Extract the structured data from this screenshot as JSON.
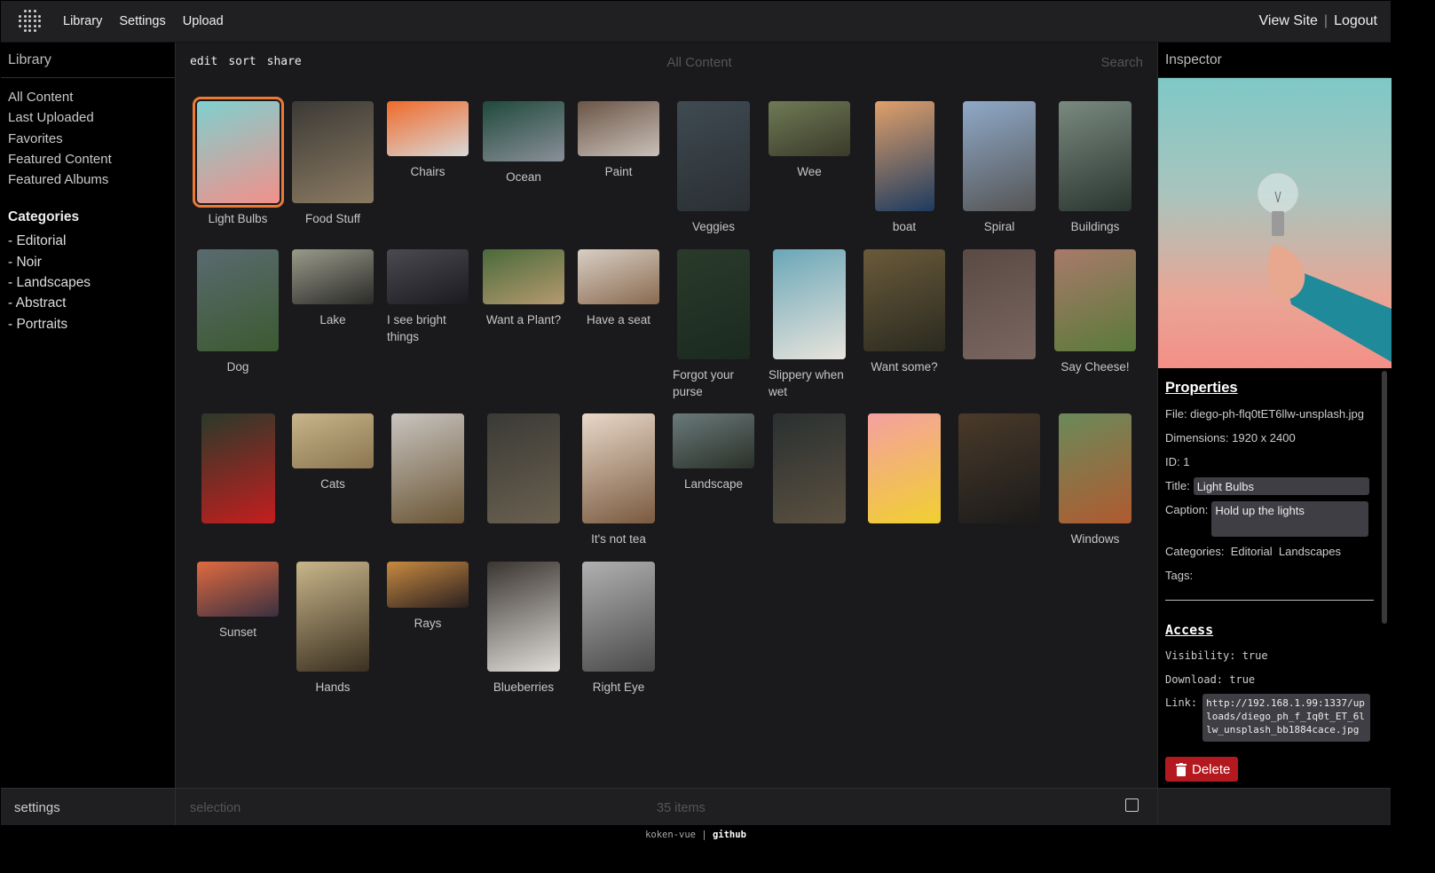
{
  "topbar": {
    "nav": [
      "Library",
      "Settings",
      "Upload"
    ],
    "view_site": "View Site",
    "separator": "|",
    "logout": "Logout"
  },
  "sidebar": {
    "title": "Library",
    "links": [
      "All Content",
      "Last Uploaded",
      "Favorites",
      "Featured Content",
      "Featured Albums"
    ],
    "categories_title": "Categories",
    "categories": [
      "- Editorial",
      "- Noir",
      "- Landscapes",
      "- Abstract",
      "- Portraits"
    ]
  },
  "toolbar": {
    "actions": [
      "edit",
      "sort",
      "share"
    ],
    "title": "All Content",
    "search_placeholder": "Search"
  },
  "items": [
    {
      "title": "Light Bulbs",
      "colors": [
        "#7fd0cf",
        "#f2908a"
      ],
      "selected": true
    },
    {
      "title": "Food Stuff",
      "colors": [
        "#3c3a36",
        "#8b7a62"
      ]
    },
    {
      "title": "Chairs",
      "colors": [
        "#f06a2a",
        "#d8d8d8"
      ]
    },
    {
      "title": "Ocean",
      "colors": [
        "#1f4a3a",
        "#8a8f9a"
      ]
    },
    {
      "title": "Paint",
      "colors": [
        "#6b5547",
        "#c9c0b8"
      ]
    },
    {
      "title": "Veggies",
      "colors": [
        "#3f4a52",
        "#2a2f33"
      ]
    },
    {
      "title": "Wee",
      "colors": [
        "#6f7a55",
        "#3a3a2a"
      ]
    },
    {
      "title": "boat",
      "colors": [
        "#e0a06a",
        "#1d3b60"
      ]
    },
    {
      "title": "Spiral",
      "colors": [
        "#8fa9c8",
        "#555555"
      ]
    },
    {
      "title": "Buildings",
      "colors": [
        "#7a8a80",
        "#2a3530"
      ]
    },
    {
      "title": "Dog",
      "colors": [
        "#5a6a70",
        "#3b5a30"
      ]
    },
    {
      "title": "Lake",
      "colors": [
        "#9a9a8a",
        "#2a2a28"
      ]
    },
    {
      "title": "I see bright things",
      "colors": [
        "#4a4a50",
        "#1a1a20"
      ]
    },
    {
      "title": "Want a Plant?",
      "colors": [
        "#4a6a3a",
        "#b59a70"
      ]
    },
    {
      "title": "Have a seat",
      "colors": [
        "#d8cfc4",
        "#8a6a50"
      ]
    },
    {
      "title": "Forgot your purse",
      "colors": [
        "#2a3a2a",
        "#1a2a1f"
      ]
    },
    {
      "title": "Slippery when wet",
      "colors": [
        "#6aa7b8",
        "#e8e4dc"
      ]
    },
    {
      "title": "Want some?",
      "colors": [
        "#6a5a3a",
        "#2a2a20"
      ]
    },
    {
      "title": "",
      "colors": [
        "#5a4a44",
        "#7a6660"
      ]
    },
    {
      "title": "Say Cheese!",
      "colors": [
        "#a87a6a",
        "#5a7a3a"
      ]
    },
    {
      "title": "",
      "colors": [
        "#2a3a2a",
        "#c41e1e"
      ]
    },
    {
      "title": "Cats",
      "colors": [
        "#c8b58a",
        "#8a7550"
      ]
    },
    {
      "title": "",
      "colors": [
        "#c8c4bf",
        "#6a5535"
      ]
    },
    {
      "title": "",
      "colors": [
        "#3a3a35",
        "#6a6050"
      ]
    },
    {
      "title": "It's not tea",
      "colors": [
        "#e8d8c8",
        "#7a5a40"
      ]
    },
    {
      "title": "Landscape",
      "colors": [
        "#6a7a7a",
        "#2a3028"
      ]
    },
    {
      "title": "",
      "colors": [
        "#2a3030",
        "#5a5040"
      ]
    },
    {
      "title": "",
      "colors": [
        "#f5a0a0",
        "#f0d030"
      ]
    },
    {
      "title": "",
      "colors": [
        "#4a3a2a",
        "#1a1a1a"
      ]
    },
    {
      "title": "Windows",
      "colors": [
        "#6a8a5a",
        "#b05a30"
      ]
    },
    {
      "title": "Sunset",
      "colors": [
        "#e06a40",
        "#3a3040"
      ]
    },
    {
      "title": "Hands",
      "colors": [
        "#c8b58a",
        "#3a3020"
      ]
    },
    {
      "title": "Rays",
      "colors": [
        "#c88a40",
        "#2a2020"
      ]
    },
    {
      "title": "Blueberries",
      "colors": [
        "#3a3530",
        "#e0ddd8"
      ]
    },
    {
      "title": "Right Eye",
      "colors": [
        "#b0b0b0",
        "#4a4a4a"
      ]
    }
  ],
  "inspector": {
    "title": "Inspector",
    "properties_title": "Properties",
    "file": "File: diego-ph-flq0tET6llw-unsplash.jpg",
    "dimensions": "Dimensions: 1920 x 2400",
    "id": "ID: 1",
    "title_label": "Title:",
    "title_value": "Light Bulbs",
    "caption_label": "Caption:",
    "caption_value": "Hold up the lights",
    "categories": "Categories:  Editorial  Landscapes",
    "tags": "Tags:",
    "access_title": "Access",
    "visibility": "Visibility: true",
    "download": "Download: true",
    "link_label": "Link:",
    "link_value": "http://192.168.1.99:1337/uploads/diego_ph_f_Iq0t_ET_6llw_unsplash_bb1884cace.jpg",
    "delete_label": "Delete"
  },
  "bottom": {
    "settings": "settings",
    "selection": "selection",
    "count": "35 items"
  },
  "footer": {
    "left": "koken-vue",
    "sep": "|",
    "right": "github"
  }
}
